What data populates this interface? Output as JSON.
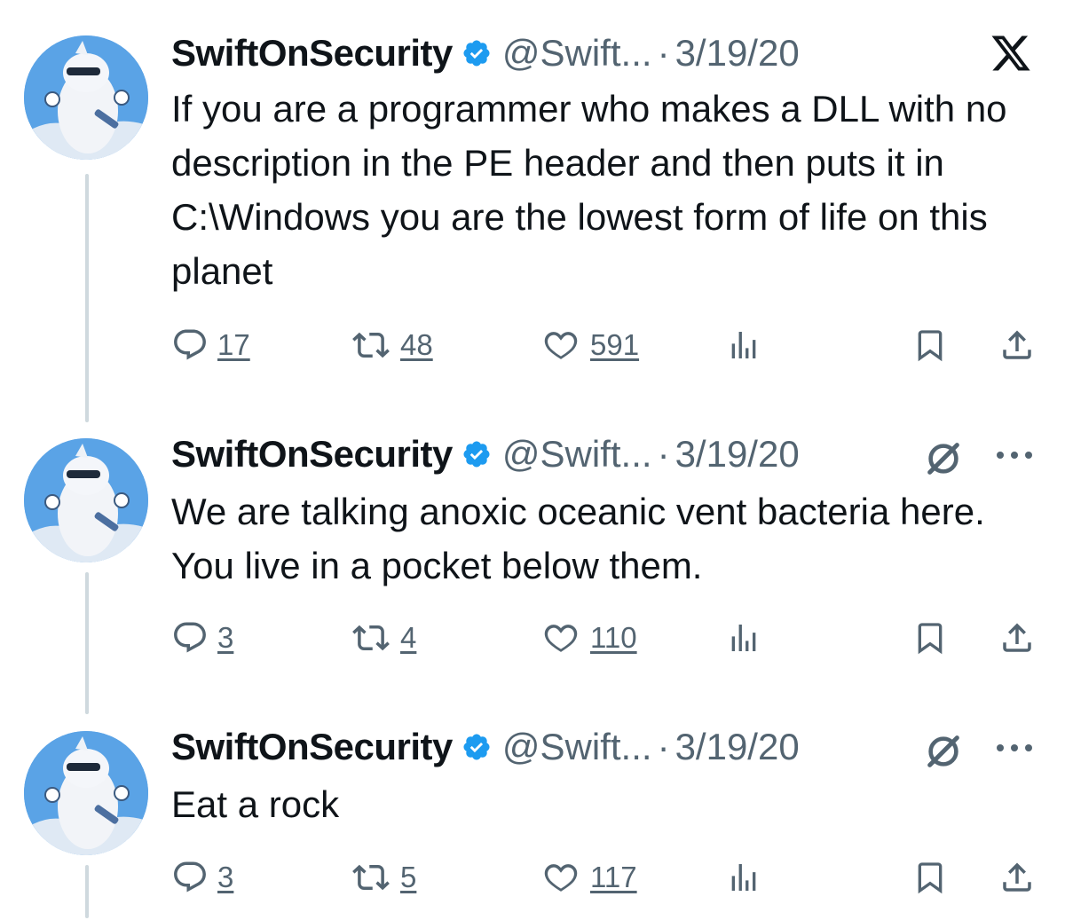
{
  "tweets": [
    {
      "name": "SwiftOnSecurity",
      "handle": "@Swift...",
      "dot": "·",
      "date": "3/19/20",
      "text": "If you are a programmer who makes a DLL with no description in the PE header and then puts it in C:\\Windows you are the lowest form of life on this planet",
      "replies": "17",
      "retweets": "48",
      "likes": "591",
      "top_right_icon": "x-logo-icon"
    },
    {
      "name": "SwiftOnSecurity",
      "handle": "@Swift...",
      "dot": "·",
      "date": "3/19/20",
      "text": "We are talking anoxic oceanic vent bacteria here. You live in a pocket below them.",
      "replies": "3",
      "retweets": "4",
      "likes": "110",
      "top_right_icon": "grok-icon"
    },
    {
      "name": "SwiftOnSecurity",
      "handle": "@Swift...",
      "dot": "·",
      "date": "3/19/20",
      "text": "Eat a rock",
      "replies": "3",
      "retweets": "5",
      "likes": "117",
      "top_right_icon": "grok-icon"
    }
  ],
  "colors": {
    "text": "#0f1419",
    "secondary": "#536471",
    "verified": "#1d9bf0",
    "thread_line": "#cfd9de"
  }
}
